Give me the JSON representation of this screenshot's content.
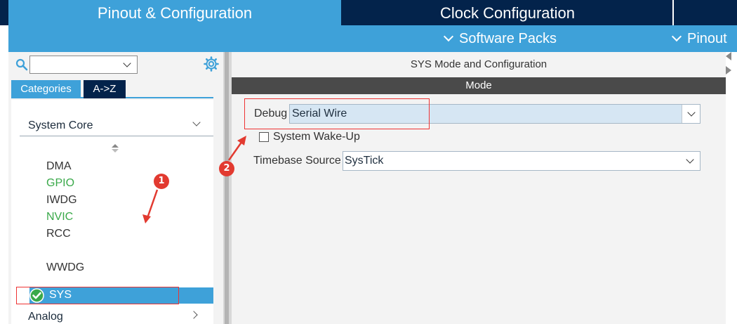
{
  "top_tabs": {
    "pinout_config": "Pinout & Configuration",
    "clock_config": "Clock Configuration"
  },
  "sub_bar": {
    "software_packs": "Software Packs",
    "pinout": "Pinout"
  },
  "left_panel": {
    "search_value": "",
    "tabs": {
      "categories": "Categories",
      "az": "A->Z"
    },
    "group_system_core": "System Core",
    "items": [
      {
        "label": "DMA",
        "status": "default"
      },
      {
        "label": "GPIO",
        "status": "configured"
      },
      {
        "label": "IWDG",
        "status": "default"
      },
      {
        "label": "NVIC",
        "status": "configured"
      },
      {
        "label": "RCC",
        "status": "default"
      },
      {
        "label": "SYS",
        "status": "selected"
      },
      {
        "label": "WWDG",
        "status": "default"
      }
    ],
    "group_analog": "Analog"
  },
  "right_panel": {
    "title": "SYS Mode and Configuration",
    "mode_header": "Mode",
    "debug_label": "Debug",
    "debug_value": "Serial Wire",
    "wakeup_label": "System Wake-Up",
    "wakeup_checked": false,
    "timebase_label": "Timebase Source",
    "timebase_value": "SysTick"
  },
  "annotations": {
    "badge_1": "1",
    "badge_2": "2"
  },
  "colors": {
    "accent_blue": "#3ea1d9",
    "dark_navy": "#03234b",
    "configured_green": "#3aa94a",
    "annotation_red": "#e23a30"
  },
  "icons": [
    "search-icon",
    "gear-icon",
    "chevron-down-icon",
    "sort-icon",
    "check-icon",
    "chevron-right-icon"
  ]
}
